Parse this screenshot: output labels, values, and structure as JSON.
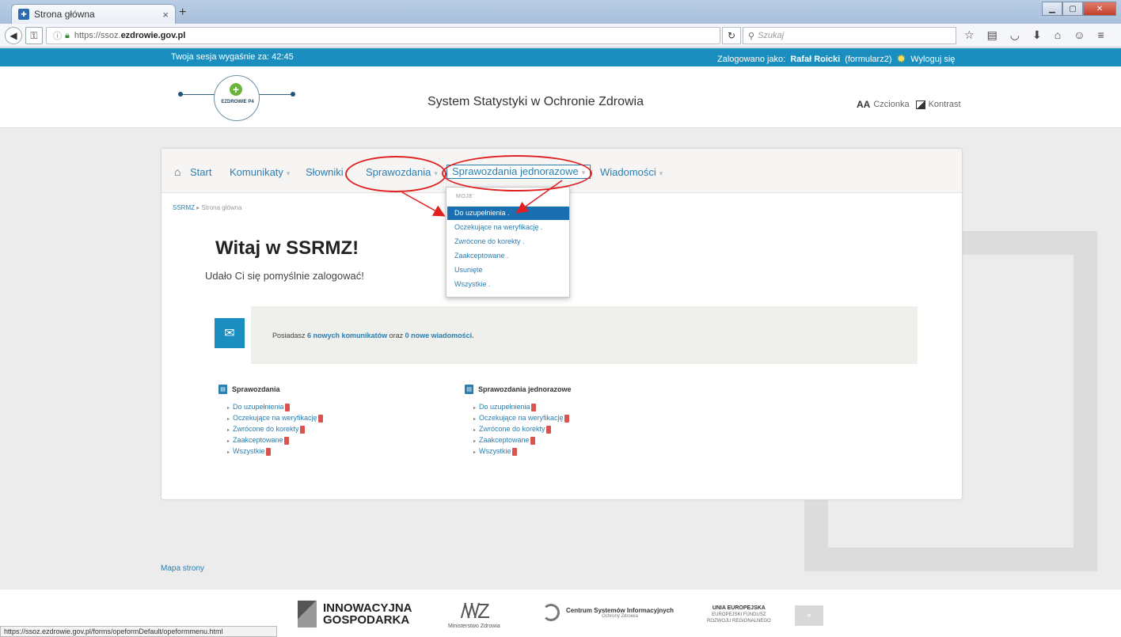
{
  "browser": {
    "tab_title": "Strona główna",
    "tab_close": "×",
    "new_tab": "+",
    "url_prefix": "https://ssoz.",
    "url_domain": "ezdrowie.gov.pl",
    "search_placeholder": "Szukaj",
    "status_url": "https://ssoz.ezdrowie.gov.pl/forms/opeformDefault/opeformmenu.html"
  },
  "sitebar": {
    "session_label": "Twoja sesja wygaśnie za: 42:45",
    "logged_as_label": "Zalogowano jako:",
    "user_name": "Rafał Roicki",
    "user_role": "(formularz2)",
    "logout": "Wyloguj się"
  },
  "header": {
    "logo_text": "EZDROWIE P4",
    "site_title": "System Statystyki w Ochronie Zdrowia",
    "font_label": "Czcionka",
    "contrast_label": "Kontrast"
  },
  "menu": {
    "start": "Start",
    "komunikaty": "Komunikaty",
    "slowniki": "Słowniki",
    "sprawozdania": "Sprawozdania",
    "jednorazowe": "Sprawozdania jednorazowe",
    "wiadomosci": "Wiadomości"
  },
  "dropdown": {
    "header": "MOJE",
    "items": [
      "Do uzupełnienia .",
      "Oczekujące na weryfikację .",
      "Zwrócone do korekty .",
      "Zaakceptowane .",
      "Usunięte",
      "Wszystkie ."
    ]
  },
  "breadcrumb": {
    "root": "SSRMZ",
    "current": "Strona główna"
  },
  "welcome": {
    "title": "Witaj w SSRMZ!",
    "subtitle": "Udało Ci się pomyślnie zalogować!"
  },
  "message": {
    "prefix": "Posiadasz",
    "new_notices": "6 nowych komunikatów",
    "middle": "oraz",
    "new_messages": "0 nowe wiadomości."
  },
  "sections": [
    {
      "title": "Sprawozdania",
      "items": [
        "Do uzupełnienia",
        "Oczekujące na weryfikację",
        "Zwrócone do korekty",
        "Zaakceptowane",
        "Wszystkie"
      ]
    },
    {
      "title": "Sprawozdania jednorazowe",
      "items": [
        "Do uzupełnienia",
        "Oczekujące na weryfikację",
        "Zwrócone do korekty",
        "Zaakceptowane",
        "Wszystkie"
      ]
    }
  ],
  "footer": {
    "sitemap": "Mapa strony",
    "innov_line1": "INNOWACYJNA",
    "innov_line2": "GOSPODARKA",
    "mz": "Ministerstwo Zdrowia",
    "csio_line1": "Centrum Systemów Informacyjnych",
    "csio_line2": "Ochrony Zdrowia",
    "ue_line1": "UNIA EUROPEJSKA",
    "ue_line2": "EUROPEJSKI FUNDUSZ",
    "ue_line3": "ROZWOJU REGIONALNEGO"
  },
  "colors": {
    "brand_blue": "#1a8fbf",
    "link": "#2a7fb0",
    "annotation_red": "#e02020",
    "badge_red": "#d9534f"
  }
}
